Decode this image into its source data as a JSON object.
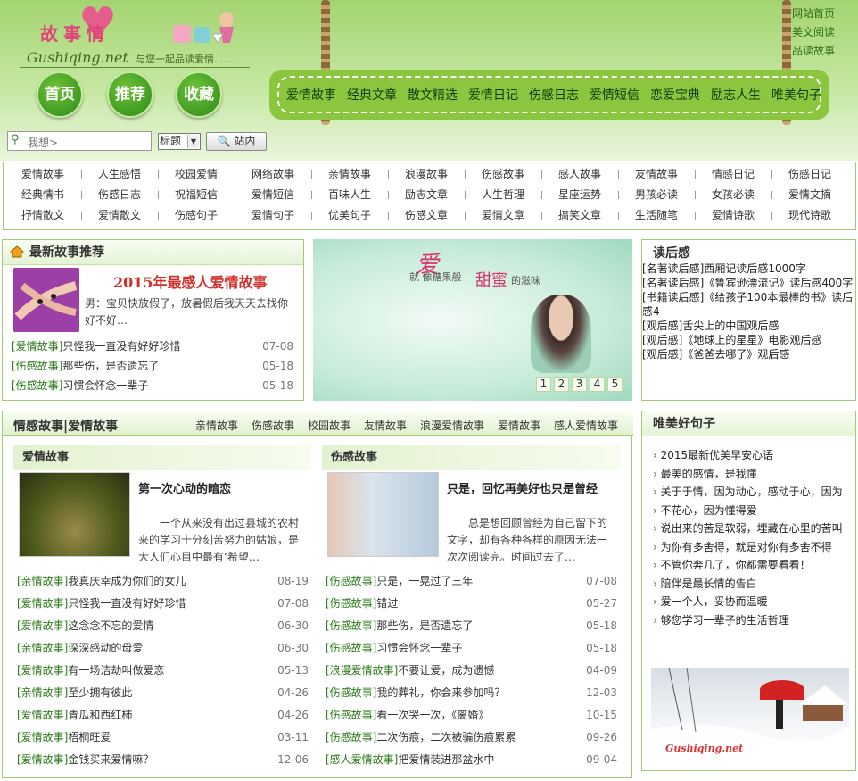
{
  "header": {
    "logo_cn": "故事情",
    "logo_en": "Gushiqing.net",
    "slogan": "与您一起品读爱情……",
    "circle_nav": [
      "首页",
      "推荐",
      "收藏"
    ],
    "top_links": [
      "网站首页",
      "美文阅读",
      "品读故事"
    ],
    "main_nav": [
      "爱情故事",
      "经典文章",
      "散文精选",
      "爱情日记",
      "伤感日志",
      "爱情短信",
      "恋爱宝典",
      "励志人生",
      "唯美句子"
    ]
  },
  "search": {
    "placeholder": "我想>",
    "select_value": "标题",
    "button_label": "站内"
  },
  "categories": [
    [
      "爱情故事",
      "人生感悟",
      "校园爱情",
      "网络故事",
      "亲情故事",
      "浪漫故事",
      "伤感故事",
      "感人故事",
      "友情故事",
      "情感日记",
      "伤感日记"
    ],
    [
      "经典情书",
      "伤感日志",
      "祝福短信",
      "爱情短信",
      "百味人生",
      "励志文章",
      "人生哲理",
      "星座运势",
      "男孩必读",
      "女孩必读",
      "爱情文摘"
    ],
    [
      "抒情散文",
      "爱情散文",
      "伤感句子",
      "爱情句子",
      "优美句子",
      "伤感文章",
      "爱情文章",
      "搞笑文章",
      "生活随笔",
      "爱情诗歌",
      "现代诗歌"
    ]
  ],
  "latest": {
    "title": "最新故事推荐",
    "feature_title": "2015年最感人爱情故事",
    "feature_desc": "男：宝贝快放假了，放暑假后我天天去找你好不好…",
    "items": [
      {
        "tag": "[爱情故事]",
        "text": "只怪我一直没有好好珍惜",
        "date": "07-08"
      },
      {
        "tag": "[伤感故事]",
        "text": "那些伤，是否遗忘了",
        "date": "05-18"
      },
      {
        "tag": "[伤感故事]",
        "text": "习惯会怀念一辈子",
        "date": "05-18"
      }
    ]
  },
  "banner": {
    "word": "爱",
    "line": "就 像糖果般",
    "sweet": "甜蜜",
    "tail": "的滋味",
    "pages": [
      "1",
      "2",
      "3",
      "4",
      "5"
    ]
  },
  "reviews": {
    "title": "读后感",
    "items": [
      "[名著读后感]西厢记读后感1000字",
      "[名著读后感]《鲁宾逊漂流记》读后感400字",
      "[书籍读后感]《给孩子100本最棒的书》读后感4",
      "[观后感]舌尖上的中国观后感",
      "[观后感]《地球上的星星》电影观后感",
      "[观后感]《爸爸去哪了》观后感"
    ]
  },
  "emotion": {
    "title": "情感故事|爱情故事",
    "tabs": [
      "亲情故事",
      "伤感故事",
      "校园故事",
      "友情故事",
      "浪漫爱情故事",
      "爱情故事",
      "感人爱情故事"
    ],
    "left": {
      "title": "爱情故事",
      "article_title": "第一次心动的暗恋",
      "article_desc": "一个从来没有出过县城的农村来的学习十分刻苦努力的姑娘，是大人们心目中最有‘希望…",
      "items": [
        {
          "tag": "[亲情故事]",
          "text": "我真庆幸成为你们的女儿",
          "date": "08-19"
        },
        {
          "tag": "[爱情故事]",
          "text": "只怪我一直没有好好珍惜",
          "date": "07-08"
        },
        {
          "tag": "[爱情故事]",
          "text": "这念念不忘的爱情",
          "date": "06-30"
        },
        {
          "tag": "[亲情故事]",
          "text": "深深感动的母爱",
          "date": "06-30"
        },
        {
          "tag": "[爱情故事]",
          "text": "有一场洁劫叫做爱恋",
          "date": "05-13"
        },
        {
          "tag": "[亲情故事]",
          "text": "至少拥有彼此",
          "date": "04-26"
        },
        {
          "tag": "[爱情故事]",
          "text": "青瓜和西红柿",
          "date": "04-26"
        },
        {
          "tag": "[爱情故事]",
          "text": "梧桐旺爱",
          "date": "03-11"
        },
        {
          "tag": "[爱情故事]",
          "text": "金钱买来爱情嘛？",
          "date": "12-06"
        }
      ]
    },
    "right": {
      "title": "伤感故事",
      "article_title": "只是，回忆再美好也只是曾经",
      "article_desc": "总是想回顾曾经为自己留下的文字，却有各种各样的原因无法一次次阅读完。时间过去了…",
      "items": [
        {
          "tag": "[伤感故事]",
          "text": "只是，一晃过了三年",
          "date": "07-08"
        },
        {
          "tag": "[伤感故事]",
          "text": "错过",
          "date": "05-27"
        },
        {
          "tag": "[伤感故事]",
          "text": "那些伤，是否遗忘了",
          "date": "05-18"
        },
        {
          "tag": "[伤感故事]",
          "text": "习惯会怀念一辈子",
          "date": "05-18"
        },
        {
          "tag": "[浪漫爱情故事]",
          "text": "不要让爱，成为遗憾",
          "date": "04-09"
        },
        {
          "tag": "[伤感故事]",
          "text": "我的葬礼，你会来参加吗？",
          "date": "12-03"
        },
        {
          "tag": "[伤感故事]",
          "text": "看一次哭一次，《离婚》",
          "date": "10-15"
        },
        {
          "tag": "[伤感故事]",
          "text": "二次伤痕，二次被骗伤痕累累",
          "date": "09-26"
        },
        {
          "tag": "[感人爱情故事]",
          "text": "把爱情装进那盆水中",
          "date": "09-04"
        }
      ]
    }
  },
  "quotes": {
    "title": "唯美好句子",
    "items": [
      "2015最新优美早安心语",
      "最美的感情，是我懂",
      "关于于情，因为动心，感动于心，因为",
      "不花心，因为懂得爱",
      "说出来的苦是软弱，埋藏在心里的苦叫",
      "为你有多舍得，就是对你有多舍不得",
      "不管你奔几了，你都需要看看！",
      "陪伴是最长情的告白",
      "爱一个人，妥协而温暖",
      "够您学习一辈子的生活哲理"
    ],
    "image_caption": "Gushiqing.net"
  },
  "colors": {
    "accent_green": "#8cc63f",
    "tag_green": "#2a7a17",
    "feature_red": "#d3302b"
  }
}
